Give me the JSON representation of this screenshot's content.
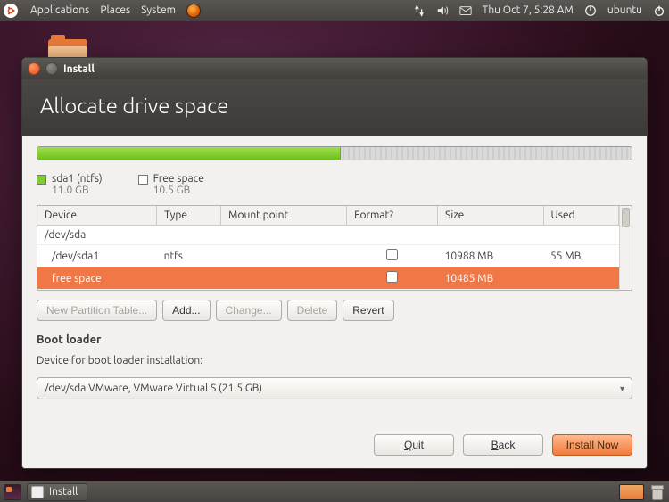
{
  "panel": {
    "menus": [
      "Applications",
      "Places",
      "System"
    ],
    "clock": "Thu Oct  7,  5:28 AM",
    "user": "ubuntu"
  },
  "window": {
    "title": "Install",
    "header": "Allocate drive space"
  },
  "drive": {
    "used_pct": 51,
    "legend": [
      {
        "swatch": "green",
        "label": "sda1 (ntfs)",
        "size": "11.0 GB"
      },
      {
        "swatch": "free",
        "label": "Free space",
        "size": "10.5 GB"
      }
    ]
  },
  "columns": [
    "Device",
    "Type",
    "Mount point",
    "Format?",
    "Size",
    "Used"
  ],
  "rows": [
    {
      "device": "/dev/sda",
      "type": "",
      "mount": "",
      "format": null,
      "size": "",
      "used": "",
      "indent": false,
      "selected": false
    },
    {
      "device": "/dev/sda1",
      "type": "ntfs",
      "mount": "",
      "format": false,
      "size": "10988 MB",
      "used": "55 MB",
      "indent": true,
      "selected": false
    },
    {
      "device": "free space",
      "type": "",
      "mount": "",
      "format": false,
      "size": "10485 MB",
      "used": "",
      "indent": true,
      "selected": true
    }
  ],
  "part_buttons": {
    "new_table": "New Partition Table...",
    "add": "Add...",
    "change": "Change...",
    "delete": "Delete",
    "revert": "Revert"
  },
  "bootloader": {
    "heading": "Boot loader",
    "label": "Device for boot loader installation:",
    "value": "/dev/sda VMware, VMware Virtual S (21.5 GB)"
  },
  "footer": {
    "quit": "Quit",
    "back": "Back",
    "install": "Install Now"
  },
  "taskbar": {
    "task": "Install"
  }
}
